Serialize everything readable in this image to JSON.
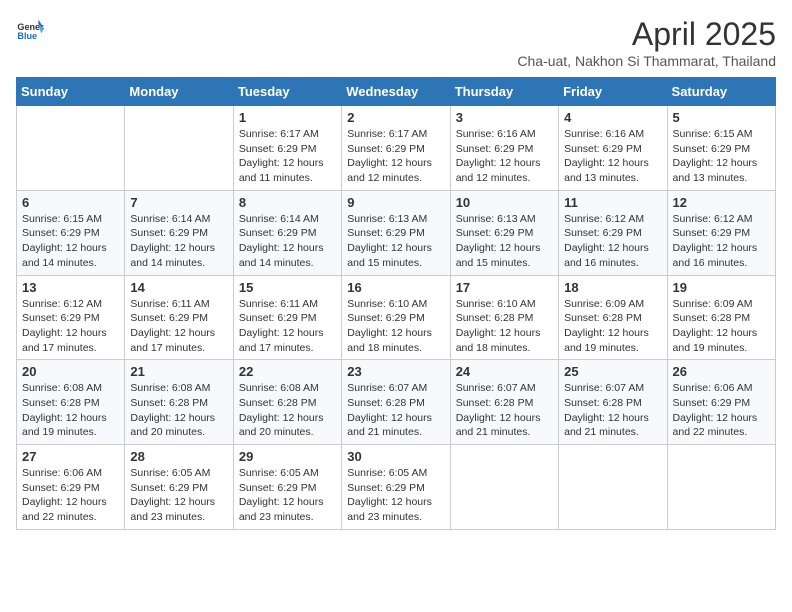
{
  "header": {
    "logo_general": "General",
    "logo_blue": "Blue",
    "month_title": "April 2025",
    "subtitle": "Cha-uat, Nakhon Si Thammarat, Thailand"
  },
  "weekdays": [
    "Sunday",
    "Monday",
    "Tuesday",
    "Wednesday",
    "Thursday",
    "Friday",
    "Saturday"
  ],
  "weeks": [
    [
      {
        "day": "",
        "info": ""
      },
      {
        "day": "",
        "info": ""
      },
      {
        "day": "1",
        "info": "Sunrise: 6:17 AM\nSunset: 6:29 PM\nDaylight: 12 hours and 11 minutes."
      },
      {
        "day": "2",
        "info": "Sunrise: 6:17 AM\nSunset: 6:29 PM\nDaylight: 12 hours and 12 minutes."
      },
      {
        "day": "3",
        "info": "Sunrise: 6:16 AM\nSunset: 6:29 PM\nDaylight: 12 hours and 12 minutes."
      },
      {
        "day": "4",
        "info": "Sunrise: 6:16 AM\nSunset: 6:29 PM\nDaylight: 12 hours and 13 minutes."
      },
      {
        "day": "5",
        "info": "Sunrise: 6:15 AM\nSunset: 6:29 PM\nDaylight: 12 hours and 13 minutes."
      }
    ],
    [
      {
        "day": "6",
        "info": "Sunrise: 6:15 AM\nSunset: 6:29 PM\nDaylight: 12 hours and 14 minutes."
      },
      {
        "day": "7",
        "info": "Sunrise: 6:14 AM\nSunset: 6:29 PM\nDaylight: 12 hours and 14 minutes."
      },
      {
        "day": "8",
        "info": "Sunrise: 6:14 AM\nSunset: 6:29 PM\nDaylight: 12 hours and 14 minutes."
      },
      {
        "day": "9",
        "info": "Sunrise: 6:13 AM\nSunset: 6:29 PM\nDaylight: 12 hours and 15 minutes."
      },
      {
        "day": "10",
        "info": "Sunrise: 6:13 AM\nSunset: 6:29 PM\nDaylight: 12 hours and 15 minutes."
      },
      {
        "day": "11",
        "info": "Sunrise: 6:12 AM\nSunset: 6:29 PM\nDaylight: 12 hours and 16 minutes."
      },
      {
        "day": "12",
        "info": "Sunrise: 6:12 AM\nSunset: 6:29 PM\nDaylight: 12 hours and 16 minutes."
      }
    ],
    [
      {
        "day": "13",
        "info": "Sunrise: 6:12 AM\nSunset: 6:29 PM\nDaylight: 12 hours and 17 minutes."
      },
      {
        "day": "14",
        "info": "Sunrise: 6:11 AM\nSunset: 6:29 PM\nDaylight: 12 hours and 17 minutes."
      },
      {
        "day": "15",
        "info": "Sunrise: 6:11 AM\nSunset: 6:29 PM\nDaylight: 12 hours and 17 minutes."
      },
      {
        "day": "16",
        "info": "Sunrise: 6:10 AM\nSunset: 6:29 PM\nDaylight: 12 hours and 18 minutes."
      },
      {
        "day": "17",
        "info": "Sunrise: 6:10 AM\nSunset: 6:28 PM\nDaylight: 12 hours and 18 minutes."
      },
      {
        "day": "18",
        "info": "Sunrise: 6:09 AM\nSunset: 6:28 PM\nDaylight: 12 hours and 19 minutes."
      },
      {
        "day": "19",
        "info": "Sunrise: 6:09 AM\nSunset: 6:28 PM\nDaylight: 12 hours and 19 minutes."
      }
    ],
    [
      {
        "day": "20",
        "info": "Sunrise: 6:08 AM\nSunset: 6:28 PM\nDaylight: 12 hours and 19 minutes."
      },
      {
        "day": "21",
        "info": "Sunrise: 6:08 AM\nSunset: 6:28 PM\nDaylight: 12 hours and 20 minutes."
      },
      {
        "day": "22",
        "info": "Sunrise: 6:08 AM\nSunset: 6:28 PM\nDaylight: 12 hours and 20 minutes."
      },
      {
        "day": "23",
        "info": "Sunrise: 6:07 AM\nSunset: 6:28 PM\nDaylight: 12 hours and 21 minutes."
      },
      {
        "day": "24",
        "info": "Sunrise: 6:07 AM\nSunset: 6:28 PM\nDaylight: 12 hours and 21 minutes."
      },
      {
        "day": "25",
        "info": "Sunrise: 6:07 AM\nSunset: 6:28 PM\nDaylight: 12 hours and 21 minutes."
      },
      {
        "day": "26",
        "info": "Sunrise: 6:06 AM\nSunset: 6:29 PM\nDaylight: 12 hours and 22 minutes."
      }
    ],
    [
      {
        "day": "27",
        "info": "Sunrise: 6:06 AM\nSunset: 6:29 PM\nDaylight: 12 hours and 22 minutes."
      },
      {
        "day": "28",
        "info": "Sunrise: 6:05 AM\nSunset: 6:29 PM\nDaylight: 12 hours and 23 minutes."
      },
      {
        "day": "29",
        "info": "Sunrise: 6:05 AM\nSunset: 6:29 PM\nDaylight: 12 hours and 23 minutes."
      },
      {
        "day": "30",
        "info": "Sunrise: 6:05 AM\nSunset: 6:29 PM\nDaylight: 12 hours and 23 minutes."
      },
      {
        "day": "",
        "info": ""
      },
      {
        "day": "",
        "info": ""
      },
      {
        "day": "",
        "info": ""
      }
    ]
  ]
}
